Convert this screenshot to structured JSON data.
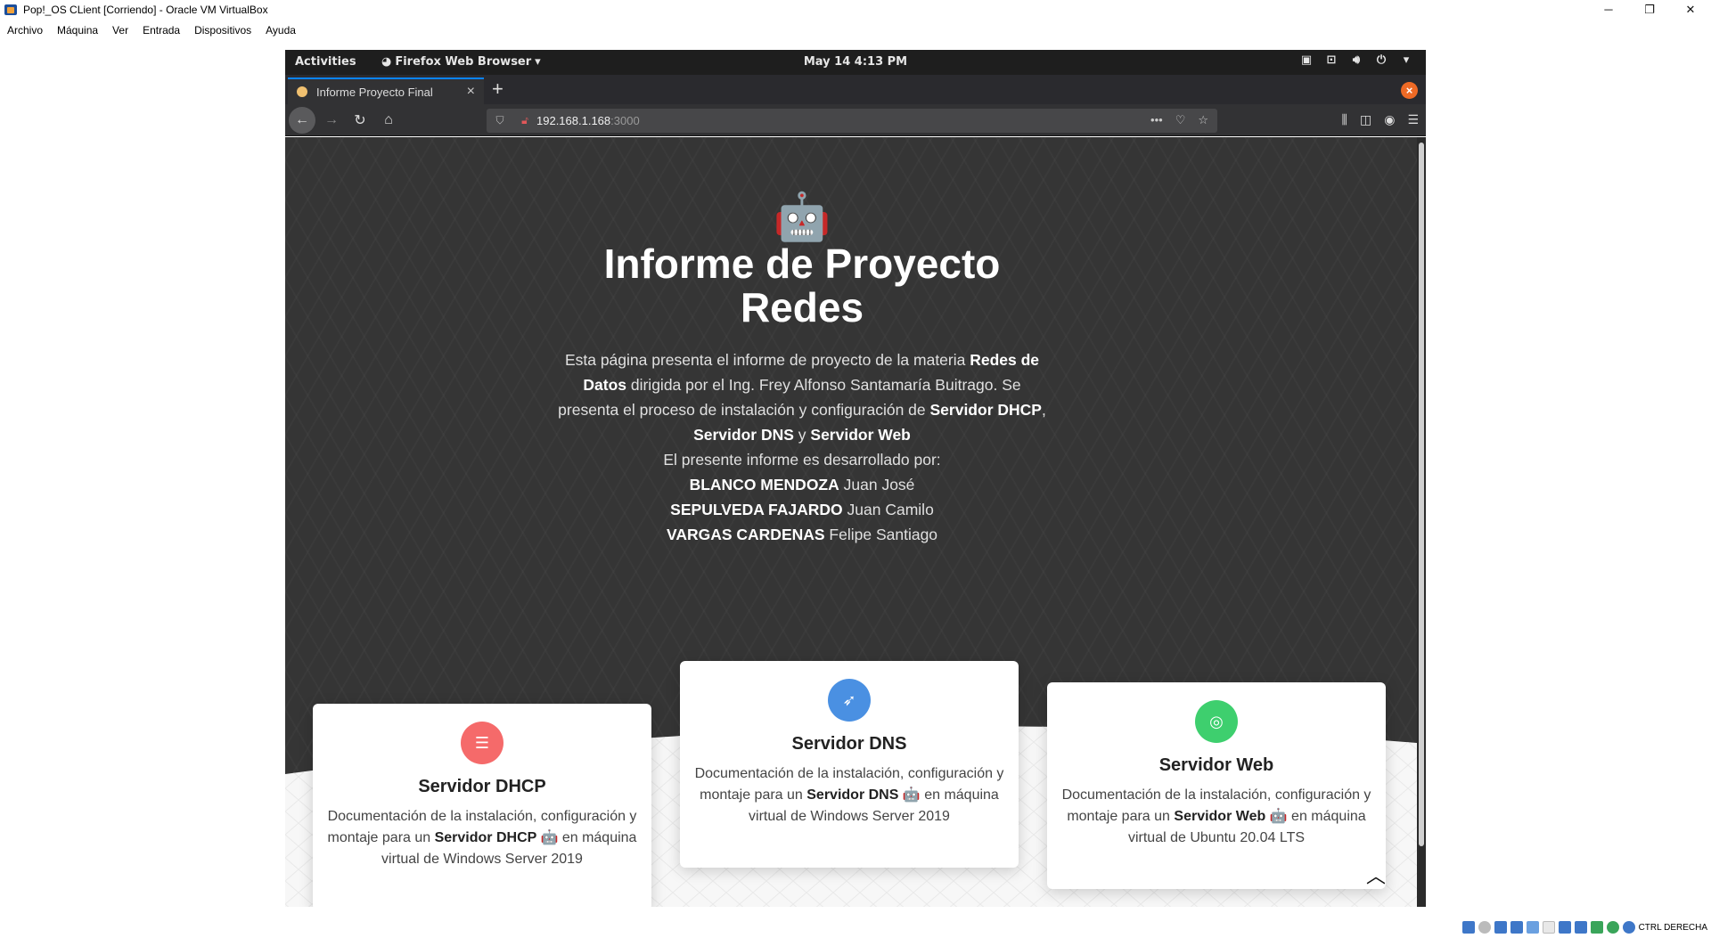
{
  "host": {
    "window_title": "Pop!_OS CLient [Corriendo] - Oracle VM VirtualBox",
    "menu": [
      "Archivo",
      "Máquina",
      "Ver",
      "Entrada",
      "Dispositivos",
      "Ayuda"
    ],
    "controls": {
      "minimize": "─",
      "restore": "❐",
      "close": "✕"
    },
    "host_key_label": "CTRL DERECHA"
  },
  "gnome": {
    "activities": "Activities",
    "app_name": "Firefox Web Browser",
    "clock": "May 14   4:13 PM"
  },
  "firefox": {
    "tab_title": "Informe Proyecto Final",
    "url_host": "192.168.1.168",
    "url_port": ":3000"
  },
  "page": {
    "robot_emoji": "🤖",
    "title": "Informe de Proyecto Redes",
    "desc_part1": "Esta página presenta el informe de proyecto de la materia ",
    "desc_bold1": "Redes de Datos",
    "desc_part2": " dirigida por el Ing. Frey Alfonso Santamaría Buitrago. Se presenta el proceso de instalación y configuración de ",
    "desc_bold2": "Servidor DHCP",
    "desc_sep": ", ",
    "desc_bold3": "Servidor DNS",
    "desc_and": " y ",
    "desc_bold4": "Servidor Web",
    "authors_intro": "El presente informe es desarrollado por:",
    "authors": [
      {
        "last": "BLANCO MENDOZA",
        "first": " Juan José"
      },
      {
        "last": "SEPULVEDA FAJARDO",
        "first": " Juan Camilo"
      },
      {
        "last": "VARGAS CARDENAS",
        "first": " Felipe Santiago"
      }
    ],
    "cards": [
      {
        "title": "Servidor DHCP",
        "icon_color": "#f56a6a",
        "desc_pre": "Documentación de la instalación, configuración y montaje para un ",
        "desc_bold": "Servidor DHCP 🤖",
        "desc_post": " en máquina virtual de Windows Server 2019"
      },
      {
        "title": "Servidor DNS",
        "icon_color": "#4a90e2",
        "desc_pre": "Documentación de la instalación, configuración y montaje para un ",
        "desc_bold": "Servidor DNS 🤖",
        "desc_post": " en máquina virtual de Windows Server 2019"
      },
      {
        "title": "Servidor Web",
        "icon_color": "#3ecf6e",
        "desc_pre": "Documentación de la instalación, configuración y montaje para un ",
        "desc_bold": "Servidor Web 🤖",
        "desc_post": " en máquina virtual de Ubuntu 20.04 LTS"
      }
    ]
  }
}
